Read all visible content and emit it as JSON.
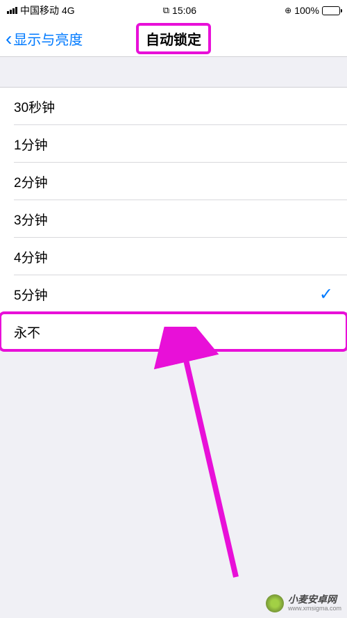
{
  "status": {
    "carrier": "中国移动",
    "network": "4G",
    "time": "15:06",
    "battery_pct": "100%"
  },
  "nav": {
    "back_label": "显示与亮度",
    "title": "自动锁定"
  },
  "options": [
    {
      "label": "30秒钟",
      "selected": false,
      "highlighted": false
    },
    {
      "label": "1分钟",
      "selected": false,
      "highlighted": false
    },
    {
      "label": "2分钟",
      "selected": false,
      "highlighted": false
    },
    {
      "label": "3分钟",
      "selected": false,
      "highlighted": false
    },
    {
      "label": "4分钟",
      "selected": false,
      "highlighted": false
    },
    {
      "label": "5分钟",
      "selected": true,
      "highlighted": false
    },
    {
      "label": "永不",
      "selected": false,
      "highlighted": true
    }
  ],
  "watermark": {
    "cn": "小麦安卓网",
    "en": "www.xmsigma.com"
  }
}
